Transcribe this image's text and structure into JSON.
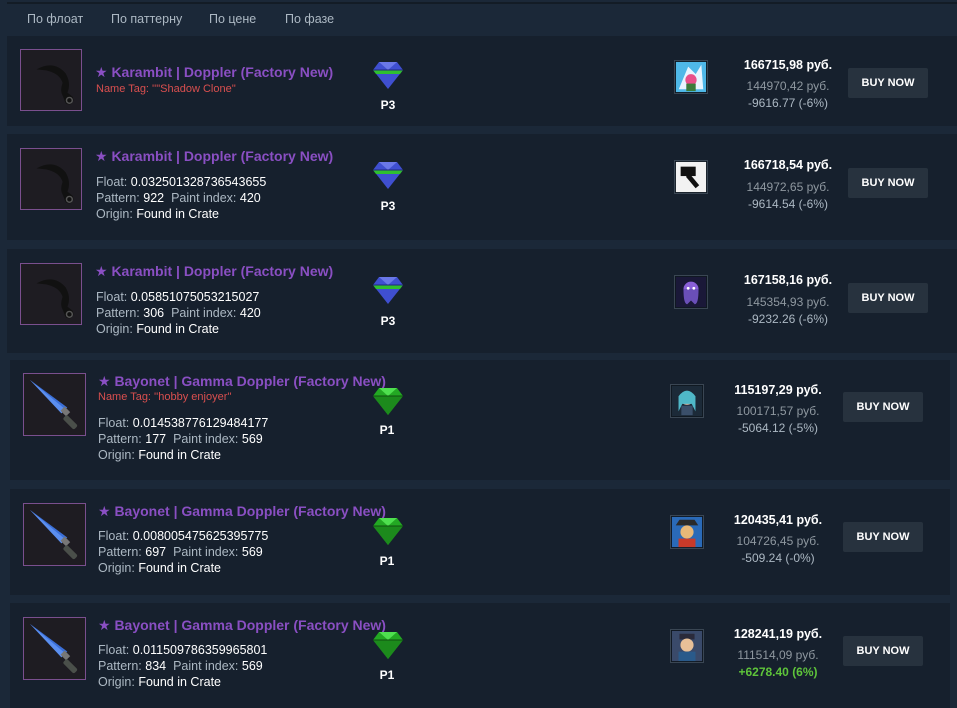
{
  "sort_tabs": [
    "По флоат",
    "По паттерну",
    "По цене",
    "По фазе"
  ],
  "buy_label": "BUY NOW",
  "float_label": "Float:",
  "pattern_label": "Pattern:",
  "paint_label": "Paint index:",
  "origin_label": "Origin:",
  "colors": {
    "title": "#8a4fc3",
    "name_tag": "#d94f4f",
    "positive": "#5ec43a",
    "p3_gem": "#3f4fd0",
    "p1_gem": "#2ec22e"
  },
  "listings": [
    {
      "title": "★ Karambit | Doppler (Factory New)",
      "weapon_icon": "karambit-icon",
      "name_tag": "Name Tag: ''\"Shadow Clone''",
      "phase": "P3",
      "gem": "sapphire-gem-icon",
      "sticker_icon": "cartoon-sticker-icon",
      "price": "166715,98 руб.",
      "base_price": "144970,42 руб.",
      "diff": "-9616.77 (-6%)"
    },
    {
      "title": "★ Karambit | Doppler (Factory New)",
      "weapon_icon": "karambit-icon",
      "float": "0.032501328736543655",
      "pattern": "922",
      "paint_index": "420",
      "origin": "Found in Crate",
      "phase": "P3",
      "gem": "sapphire-gem-icon",
      "sticker_icon": "hammer-sticker-icon",
      "price": "166718,54 руб.",
      "base_price": "144972,65 руб.",
      "diff": "-9614.54 (-6%)"
    },
    {
      "title": "★ Karambit | Doppler (Factory New)",
      "weapon_icon": "karambit-icon",
      "float": "0.05851075053215027",
      "pattern": "306",
      "paint_index": "420",
      "origin": "Found in Crate",
      "phase": "P3",
      "gem": "sapphire-gem-icon",
      "sticker_icon": "ghost-sticker-icon",
      "price": "167158,16 руб.",
      "base_price": "145354,93 руб.",
      "diff": "-9232.26 (-6%)"
    },
    {
      "title": "★ Bayonet | Gamma Doppler (Factory New)",
      "weapon_icon": "bayonet-icon",
      "name_tag": "Name Tag: ''hobby enjoyer''",
      "float": "0.014538776129484177",
      "pattern": "177",
      "paint_index": "569",
      "origin": "Found in Crate",
      "phase": "P1",
      "gem": "emerald-gem-icon",
      "sticker_icon": "anime-girl-sticker-icon",
      "price": "115197,29 руб.",
      "base_price": "100171,57 руб.",
      "diff": "-5064.12 (-5%)"
    },
    {
      "title": "★ Bayonet | Gamma Doppler (Factory New)",
      "weapon_icon": "bayonet-icon",
      "float": "0.008005475625395775",
      "pattern": "697",
      "paint_index": "569",
      "origin": "Found in Crate",
      "phase": "P1",
      "gem": "emerald-gem-icon",
      "sticker_icon": "pirate-sticker-icon",
      "price": "120435,41 руб.",
      "base_price": "104726,45 руб.",
      "diff": "-509.24 (-0%)"
    },
    {
      "title": "★ Bayonet | Gamma Doppler (Factory New)",
      "weapon_icon": "bayonet-icon",
      "float": "0.011509786359965801",
      "pattern": "834",
      "paint_index": "569",
      "origin": "Found in Crate",
      "phase": "P1",
      "gem": "emerald-gem-icon",
      "sticker_icon": "character-sticker-icon",
      "price": "128241,19 руб.",
      "base_price": "111514,09 руб.",
      "diff": "+6278.40 (6%)",
      "diff_positive": true
    }
  ]
}
